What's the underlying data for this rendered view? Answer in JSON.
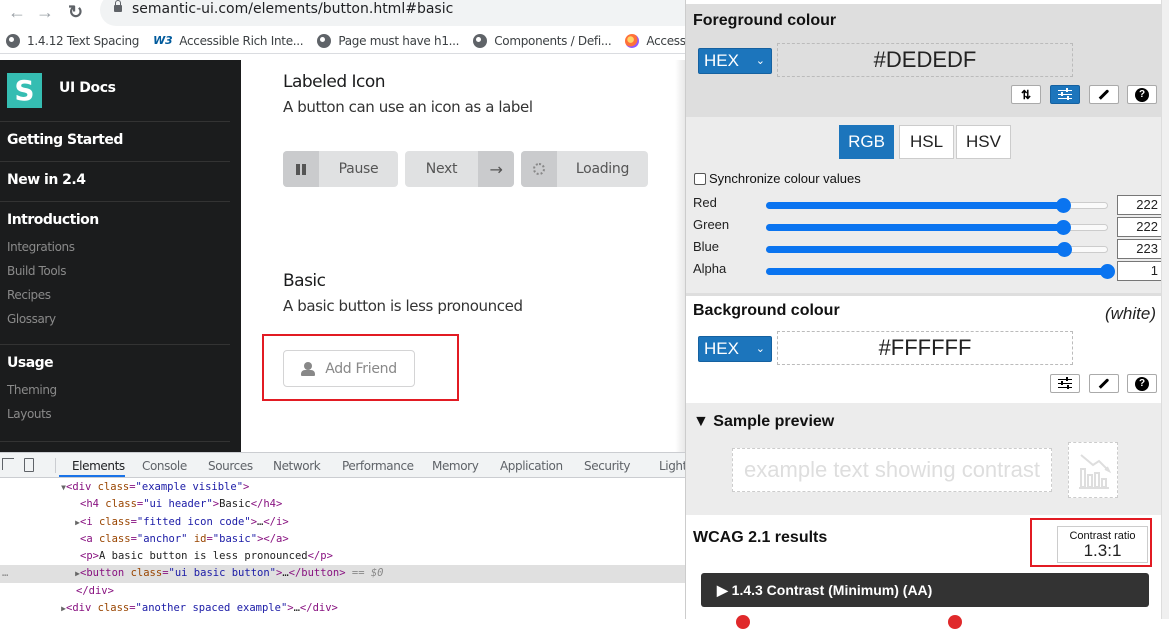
{
  "browser": {
    "url": "semantic-ui.com/elements/button.html#basic",
    "bookmarks": [
      {
        "icon": "globe-icon",
        "label": "1.4.12 Text Spacing"
      },
      {
        "icon": "w3c-icon",
        "label": "Accessible Rich Inte..."
      },
      {
        "icon": "globe-icon",
        "label": "Page must have h1..."
      },
      {
        "icon": "globe-icon",
        "label": "Components / Defi..."
      },
      {
        "icon": "firefox-icon",
        "label": "Accessibility"
      }
    ],
    "w3_glyph": "W3"
  },
  "sidebar": {
    "logo_letter": "S",
    "brand": "UI Docs",
    "sections": [
      {
        "label": "Getting Started"
      },
      {
        "label": "New in 2.4"
      },
      {
        "label": "Introduction",
        "items": [
          "Integrations",
          "Build Tools",
          "Recipes",
          "Glossary"
        ]
      },
      {
        "label": "Usage",
        "items": [
          "Theming",
          "Layouts"
        ]
      }
    ]
  },
  "main": {
    "labeled_icon": {
      "title": "Labeled Icon",
      "description": "A button can use an icon as a label",
      "buttons": [
        {
          "label": "Pause",
          "icon": "pause-icon"
        },
        {
          "label": "Next",
          "icon": "arrow-right-icon",
          "arrow": "→"
        },
        {
          "label": "Loading",
          "icon": "spinner-icon"
        }
      ]
    },
    "basic": {
      "title": "Basic",
      "description": "A basic button is less pronounced",
      "button_label": "Add Friend"
    }
  },
  "devtools": {
    "tabs": [
      "Elements",
      "Console",
      "Sources",
      "Network",
      "Performance",
      "Memory",
      "Application",
      "Security",
      "Light"
    ],
    "active_tab": "Elements",
    "lines": [
      {
        "tri": "▼",
        "open": "<div ",
        "attr": "class",
        "val": "\"example visible\"",
        "close": ">",
        "text": "",
        "end": ""
      },
      {
        "tri": "",
        "open": "<h4 ",
        "attr": "class",
        "val": "\"ui header\"",
        "close": ">",
        "text": "Basic",
        "end": "</h4>"
      },
      {
        "tri": "▶",
        "open": "<i ",
        "attr": "class",
        "val": "\"fitted icon code\"",
        "close": ">",
        "text": "…",
        "end": "</i>"
      },
      {
        "tri": "",
        "open": "<a ",
        "attr": "class",
        "val": "\"anchor\"",
        "attr2": "id",
        "val2": "\"basic\"",
        "close": ">",
        "text": "",
        "end": "</a>"
      },
      {
        "tri": "",
        "open": "<p",
        "attr": "",
        "val": "",
        "close": ">",
        "text": "A basic button is less pronounced",
        "end": "</p>"
      },
      {
        "tri": "▶",
        "open": "<button ",
        "attr": "class",
        "val": "\"ui basic button\"",
        "close": ">",
        "text": "…",
        "end": "</button>",
        "suffix": " == $0",
        "selected": true
      },
      {
        "tri": "",
        "open": "</div>",
        "attr": "",
        "val": "",
        "close": "",
        "text": "",
        "end": ""
      },
      {
        "tri": "▶",
        "open": "<div ",
        "attr": "class",
        "val": "\"another spaced example\"",
        "close": ">",
        "text": "…",
        "end": "</div>"
      }
    ]
  },
  "contrast_panel": {
    "foreground": {
      "title": "Foreground colour",
      "format": "HEX",
      "value": "#DEDEDF",
      "tools": [
        "swap-icon",
        "sliders-icon",
        "eyedropper-icon",
        "help-icon"
      ],
      "swap_glyph": "⇅",
      "help_glyph": "?"
    },
    "modes": [
      "RGB",
      "HSL",
      "HSV"
    ],
    "active_mode": "RGB",
    "sync_label": "Synchronize colour values",
    "sync_checked": false,
    "channels": [
      {
        "label": "Red",
        "value": "222",
        "fraction": 0.8706
      },
      {
        "label": "Green",
        "value": "222",
        "fraction": 0.8706
      },
      {
        "label": "Blue",
        "value": "223",
        "fraction": 0.8745
      },
      {
        "label": "Alpha",
        "value": "1",
        "fraction": 1.0
      }
    ],
    "background": {
      "title": "Background colour",
      "name": "(white)",
      "format": "HEX",
      "value": "#FFFFFF",
      "help_glyph": "?"
    },
    "preview": {
      "title": "▼ Sample preview",
      "sample_text": "example text showing contrast"
    },
    "wcag": {
      "title": "WCAG 2.1 results",
      "ratio_label": "Contrast ratio",
      "ratio_value": "1.3:1",
      "criterion": "▶  1.4.3 Contrast (Minimum) (AA)"
    },
    "colors": {
      "accent": "#1c75bc",
      "slider": "#0a74f0",
      "highlight": "#e21b23",
      "foreground": "#dedede",
      "background": "#ffffff"
    }
  }
}
